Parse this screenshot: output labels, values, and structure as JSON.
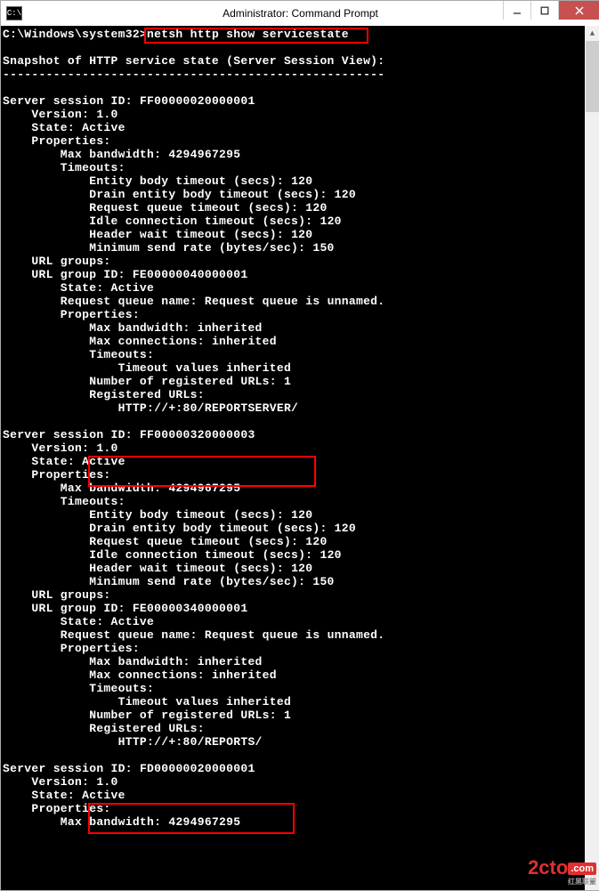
{
  "title": "Administrator: Command Prompt",
  "icon_text": "C:\\",
  "prompt_prefix": "C:\\Windows\\system32>",
  "command": "netsh http show servicestate",
  "snapshot_header": "Snapshot of HTTP service state (Server Session View):",
  "divider": "-----------------------------------------------------",
  "sessions": [
    {
      "id": "FF00000020000001",
      "version": "1.0",
      "state": "Active",
      "max_bw": "4294967295",
      "entity_body_timeout": "120",
      "drain_entity_body_timeout": "120",
      "request_queue_timeout": "120",
      "idle_conn_timeout": "120",
      "header_wait_timeout": "120",
      "min_send_rate": "150",
      "url_group_id": "FE00000040000001",
      "url_state": "Active",
      "req_queue_name": "Request queue is unnamed.",
      "max_bw_inh": "inherited",
      "max_conn_inh": "inherited",
      "timeout_vals": "Timeout values inherited",
      "num_reg_urls": "1",
      "registered_url": "HTTP://+:80/REPORTSERVER/"
    },
    {
      "id": "FF00000320000003",
      "version": "1.0",
      "state": "Active",
      "max_bw": "4294967295",
      "entity_body_timeout": "120",
      "drain_entity_body_timeout": "120",
      "request_queue_timeout": "120",
      "idle_conn_timeout": "120",
      "header_wait_timeout": "120",
      "min_send_rate": "150",
      "url_group_id": "FE00000340000001",
      "url_state": "Active",
      "req_queue_name": "Request queue is unnamed.",
      "max_bw_inh": "inherited",
      "max_conn_inh": "inherited",
      "timeout_vals": "Timeout values inherited",
      "num_reg_urls": "1",
      "registered_url": "HTTP://+:80/REPORTS/"
    },
    {
      "id": "FD00000020000001",
      "version": "1.0",
      "state": "Active",
      "max_bw": "4294967295"
    }
  ],
  "watermark": {
    "brand": "2cto",
    "tld": ".com",
    "sub": "红黑联盟"
  }
}
